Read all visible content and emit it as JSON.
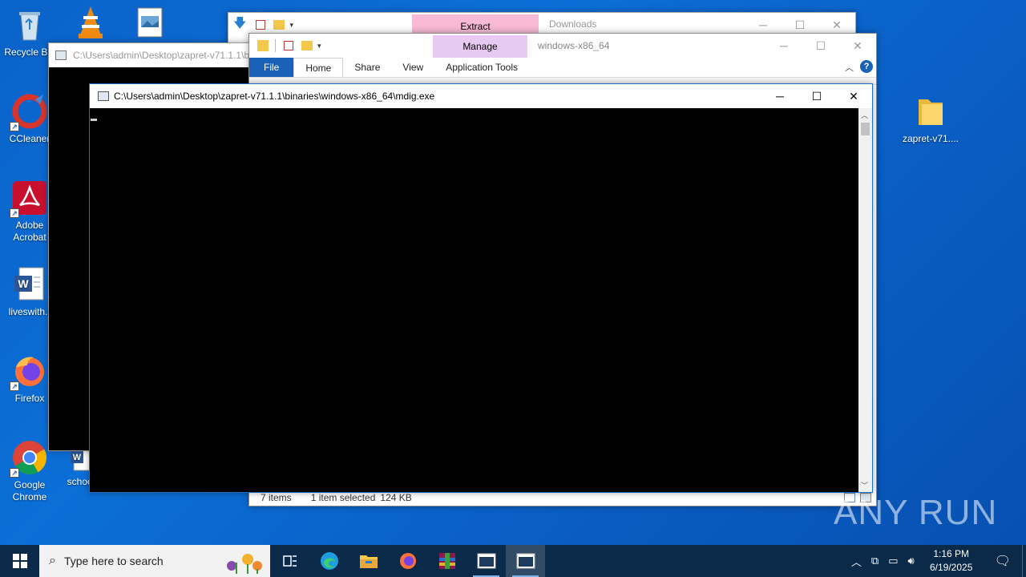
{
  "desktop": {
    "icons": [
      {
        "id": "recycle",
        "label": "Recycle Bin"
      },
      {
        "id": "ccleaner",
        "label": "CCleaner"
      },
      {
        "id": "acrobat",
        "label": "Adobe Acrobat"
      },
      {
        "id": "liveswith",
        "label": "liveswith.r"
      },
      {
        "id": "firefox",
        "label": "Firefox"
      },
      {
        "id": "chrome",
        "label": "Google Chrome"
      },
      {
        "id": "school",
        "label": "school"
      },
      {
        "id": "zapret",
        "label": "zapret-v71...."
      }
    ]
  },
  "explorer_back": {
    "title": "Downloads",
    "context_tab": "Extract"
  },
  "explorer_front": {
    "title": "windows-x86_64",
    "context_tab": "Manage",
    "tabs": [
      "File",
      "Home",
      "Share",
      "View",
      "Application Tools"
    ],
    "status": {
      "items": "7 items",
      "selected": "1 item selected",
      "size": "124 KB"
    }
  },
  "console_back": {
    "title": "C:\\Users\\admin\\Desktop\\zapret-v71.1.1\\b"
  },
  "console_front": {
    "title": "C:\\Users\\admin\\Desktop\\zapret-v71.1.1\\binaries\\windows-x86_64\\mdig.exe"
  },
  "watermark": "ANY RUN",
  "taskbar": {
    "search_placeholder": "Type here to search",
    "time": "1:16 PM",
    "date": "6/19/2025"
  }
}
